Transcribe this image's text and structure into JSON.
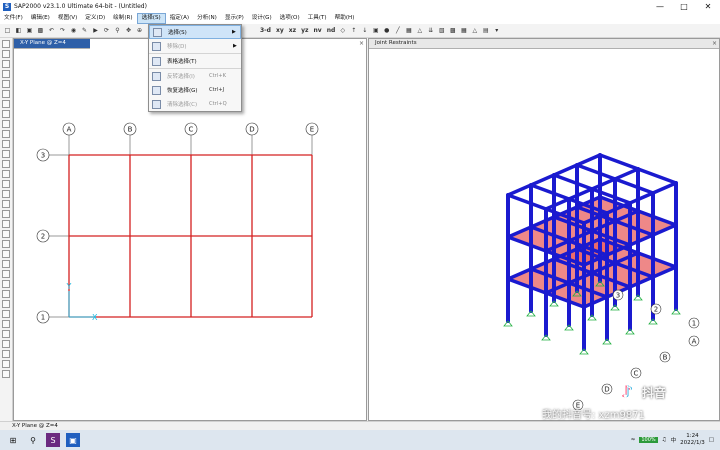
{
  "window": {
    "title": "SAP2000 v23.1.0 Ultimate 64-bit - (Untitled)",
    "app_icon": "S"
  },
  "menubar": [
    {
      "label": "文件(F)"
    },
    {
      "label": "编辑(E)"
    },
    {
      "label": "视图(V)"
    },
    {
      "label": "定义(D)"
    },
    {
      "label": "绘制(R)"
    },
    {
      "label": "选择(S)",
      "active": true
    },
    {
      "label": "指定(A)"
    },
    {
      "label": "分析(N)"
    },
    {
      "label": "显示(P)"
    },
    {
      "label": "设计(G)"
    },
    {
      "label": "选项(O)"
    },
    {
      "label": "工具(T)"
    },
    {
      "label": "帮助(H)"
    }
  ],
  "toolbar": {
    "view_labels": [
      "3-d",
      "xy",
      "xz",
      "yz",
      "nv",
      "nd"
    ]
  },
  "select_menu": {
    "items": [
      {
        "label": "选择(S)",
        "shortcut": "",
        "enabled": true,
        "submenu": true,
        "highlight": true
      },
      {
        "label": "移除(D)",
        "shortcut": "",
        "enabled": false,
        "submenu": true
      },
      {
        "label": "表格选择(T)",
        "shortcut": "",
        "enabled": true,
        "sep": true
      },
      {
        "label": "反转选择(I)",
        "shortcut": "Ctrl+K",
        "enabled": false,
        "sep": true
      },
      {
        "label": "恢复选择(G)",
        "shortcut": "Ctrl+J",
        "enabled": true
      },
      {
        "label": "清除选择(C)",
        "shortcut": "Ctrl+Q",
        "enabled": false
      }
    ]
  },
  "left_panel": {
    "title": "X-Y Plane @ Z=4",
    "close_icon": "×",
    "grid_x_labels": [
      "A",
      "B",
      "C",
      "D",
      "E"
    ],
    "grid_y_labels": [
      "3",
      "2",
      "1"
    ]
  },
  "right_panel": {
    "title": "Joint Restraints",
    "close_icon": "×",
    "grid_labels_x": [
      "A",
      "B",
      "C",
      "D",
      "E"
    ],
    "grid_labels_y": [
      "1",
      "2",
      "3"
    ]
  },
  "statusbar": {
    "text": "X-Y Plane @ Z=4"
  },
  "taskbar": {
    "time": "1:24",
    "date": "2022/1/3",
    "battery": "100%"
  },
  "watermark": {
    "name": "抖音",
    "id": "我的抖音号: xzm9871"
  },
  "colors": {
    "frame_blue": "#1a1acf",
    "floor_fill": "#e86060",
    "grid_red": "#d42020",
    "accent": "#2e5fa8"
  }
}
